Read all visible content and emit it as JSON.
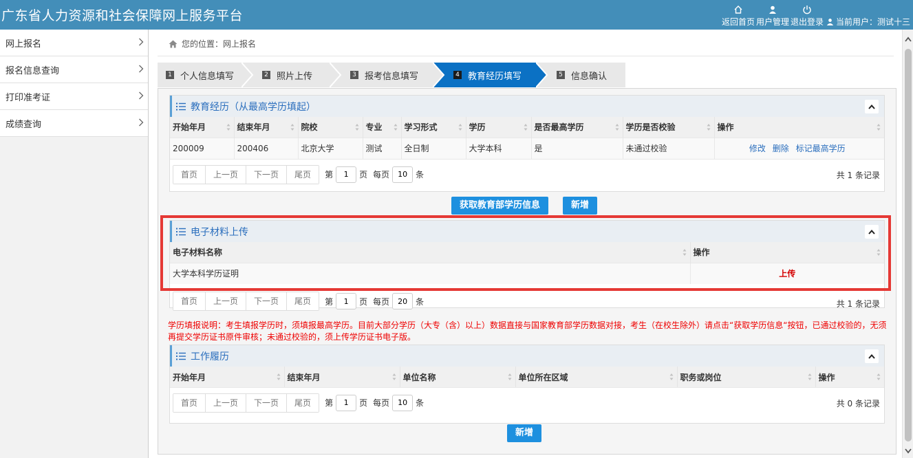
{
  "header": {
    "title": "广东省人力资源和社会保障网上服务平台",
    "nav": [
      "返回首页",
      "用户管理",
      "退出登录"
    ],
    "current_user": "当前用户：测试十三"
  },
  "sidebar": {
    "items": [
      {
        "label": "网上报名"
      },
      {
        "label": "报名信息查询"
      },
      {
        "label": "打印准考证"
      },
      {
        "label": "成绩查询"
      }
    ]
  },
  "breadcrumb": "您的位置：网上报名",
  "wizard": {
    "steps": [
      {
        "num": "1",
        "label": "个人信息填写"
      },
      {
        "num": "2",
        "label": "照片上传"
      },
      {
        "num": "3",
        "label": "报考信息填写"
      },
      {
        "num": "4",
        "label": "教育经历填写",
        "active": true
      },
      {
        "num": "5",
        "label": "信息确认"
      }
    ]
  },
  "education": {
    "title": "教育经历（从最高学历填起）",
    "columns": [
      "开始年月",
      "结束年月",
      "院校",
      "专业",
      "学习形式",
      "学历",
      "是否最高学历",
      "学历是否校验",
      "操作"
    ],
    "rows": [
      {
        "start": "200009",
        "end": "200406",
        "school": "北京大学",
        "major": "测试",
        "form": "全日制",
        "degree": "大学本科",
        "highest": "是",
        "verified": "未通过校验",
        "ops": [
          "修改",
          "删除",
          "标记最高学历"
        ]
      }
    ],
    "pager": {
      "first": "首页",
      "prev": "上一页",
      "next": "下一页",
      "last": "尾页",
      "page_label": "第",
      "page": "1",
      "page_unit": "页",
      "per_label": "每页",
      "per": "10",
      "per_unit": "条",
      "total": "共 1 条记录"
    },
    "btn_fetch": "获取教育部学历信息",
    "btn_add": "新增"
  },
  "materials": {
    "title": "电子材料上传",
    "columns": [
      "电子材料名称",
      "操作"
    ],
    "rows": [
      {
        "name": "大学本科学历证明",
        "op": "上传"
      }
    ],
    "pager": {
      "first": "首页",
      "prev": "上一页",
      "next": "下一页",
      "last": "尾页",
      "page_label": "第",
      "page": "1",
      "page_unit": "页",
      "per_label": "每页",
      "per": "20",
      "per_unit": "条",
      "total": "共 1 条记录"
    }
  },
  "note": "学历填报说明：考生填报学历时，须填报最高学历。目前大部分学历（大专（含）以上）数据直接与国家教育部学历数据对接，考生（在校生除外）请点击“获取学历信息“按钮，已通过校验的，无须再提交学历证书原件审核；未通过校验的，须上传学历证书电子版。",
  "work": {
    "title": "工作履历",
    "columns": [
      "开始年月",
      "结束年月",
      "单位名称",
      "单位所在区域",
      "职务或岗位",
      "操作"
    ],
    "pager": {
      "first": "首页",
      "prev": "上一页",
      "next": "下一页",
      "last": "尾页",
      "page_label": "第",
      "page": "1",
      "page_unit": "页",
      "per_label": "每页",
      "per": "10",
      "per_unit": "条",
      "total": "共 0 条记录"
    },
    "btn_add": "新增"
  },
  "colors": {
    "header": "#438eb9",
    "active_step": "#0b71c4",
    "button": "#1e90df",
    "highlight": "#e53935",
    "note": "#ee0000"
  }
}
